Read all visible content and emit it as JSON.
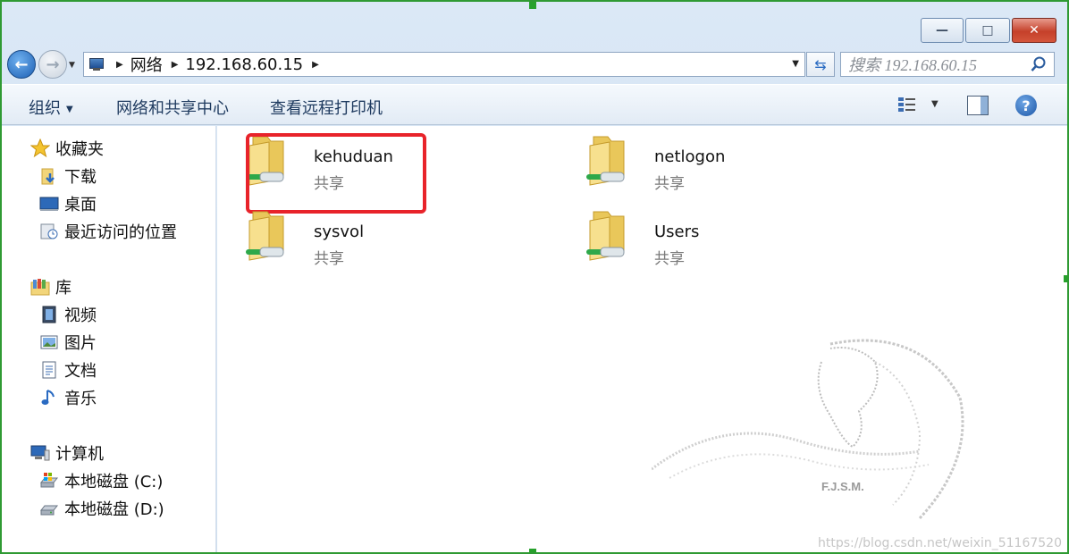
{
  "window": {
    "controls": {
      "minimize": "—",
      "maximize": "□",
      "close": "✕"
    }
  },
  "address": {
    "back": "←",
    "forward": "→",
    "breadcrumb": [
      "网络",
      "192.168.60.15"
    ],
    "refresh": "⇆"
  },
  "search": {
    "placeholder": "搜索 192.168.60.15"
  },
  "toolbar": {
    "organize": "组织",
    "network_center": "网络和共享中心",
    "remote_printers": "查看远程打印机",
    "help": "?"
  },
  "sidebar": {
    "favorites": {
      "label": "收藏夹",
      "items": [
        "下载",
        "桌面",
        "最近访问的位置"
      ]
    },
    "libraries": {
      "label": "库",
      "items": [
        "视频",
        "图片",
        "文档",
        "音乐"
      ]
    },
    "computer": {
      "label": "计算机",
      "items": [
        "本地磁盘 (C:)",
        "本地磁盘 (D:)"
      ]
    }
  },
  "shares": [
    {
      "name": "kehuduan",
      "type": "共享",
      "highlighted": true
    },
    {
      "name": "netlogon",
      "type": "共享"
    },
    {
      "name": "sysvol",
      "type": "共享"
    },
    {
      "name": "Users",
      "type": "共享"
    }
  ],
  "watermark": {
    "logo_text": "F.J.S.M.",
    "url": "https://blog.csdn.net/weixin_51167520"
  },
  "colors": {
    "highlight": "#e8232a",
    "frame": "#2f9a33"
  }
}
